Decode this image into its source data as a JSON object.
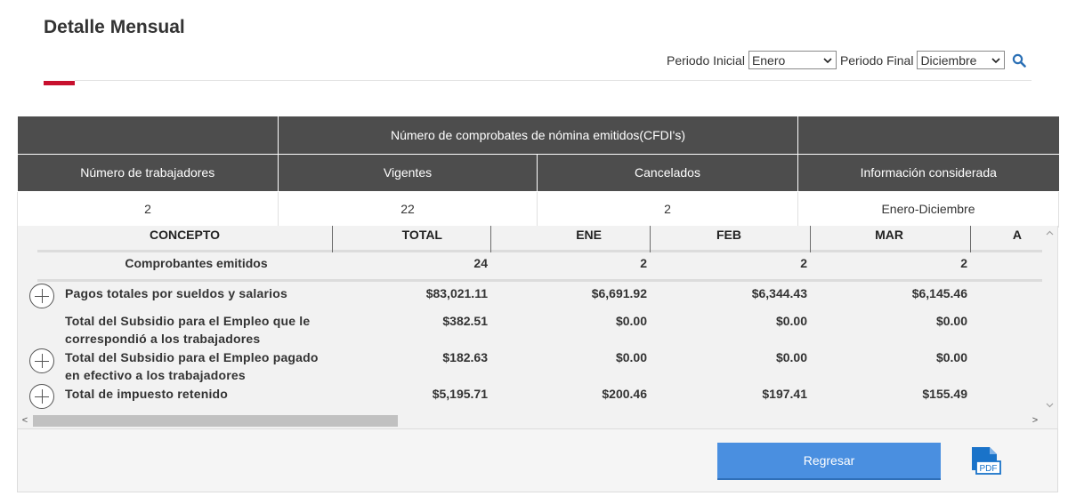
{
  "page": {
    "title": "Detalle Mensual"
  },
  "filters": {
    "initial_label": "Periodo Inicial",
    "initial_value": "Enero",
    "final_label": "Periodo Final",
    "final_value": "Diciembre",
    "search_icon": "search-icon"
  },
  "summary": {
    "group_header": "Número de comprobates de nómina emitidos(CFDI's)",
    "headers": [
      "Número de trabajadores",
      "Vigentes",
      "Cancelados",
      "Información considerada"
    ],
    "values": [
      "2",
      "22",
      "2",
      "Enero-Diciembre"
    ]
  },
  "detail": {
    "columns": [
      "CONCEPTO",
      "TOTAL",
      "ENE",
      "FEB",
      "MAR",
      "A"
    ],
    "rows": [
      {
        "concept": "Comprobantes emitidos",
        "values": [
          "24",
          "2",
          "2",
          "2"
        ],
        "expandable": false
      },
      {
        "concept": "Pagos totales por sueldos y salarios",
        "values": [
          "$83,021.11",
          "$6,691.92",
          "$6,344.43",
          "$6,145.46"
        ],
        "expandable": true
      },
      {
        "concept_line1": "Total del Subsidio para el Empleo que le",
        "concept_line2": "correspondió a los trabajadores",
        "values": [
          "$382.51",
          "$0.00",
          "$0.00",
          "$0.00"
        ],
        "expandable": false
      },
      {
        "concept_line1": "Total del Subsidio para el Empleo pagado",
        "concept_line2": "en efectivo a los trabajadores",
        "values": [
          "$182.63",
          "$0.00",
          "$0.00",
          "$0.00"
        ],
        "expandable": true
      },
      {
        "concept": "Total de impuesto retenido",
        "values": [
          "$5,195.71",
          "$200.46",
          "$197.41",
          "$155.49"
        ],
        "expandable": true
      }
    ]
  },
  "scroll": {
    "left_arrow": "<",
    "right_arrow": ">",
    "up_arrow": "^",
    "down_arrow": "v"
  },
  "footer": {
    "back_label": "Regresar",
    "pdf_label": "PDF"
  },
  "colors": {
    "header_bg": "#4d4d4d",
    "accent_red": "#c8102e",
    "button_blue": "#4a8fe0",
    "pdf_blue": "#1a73c9"
  }
}
